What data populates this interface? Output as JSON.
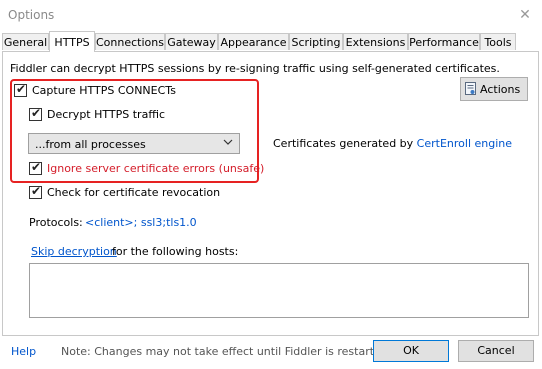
{
  "window": {
    "title": "Options"
  },
  "tabs": [
    {
      "label": "General"
    },
    {
      "label": "HTTPS"
    },
    {
      "label": "Connections"
    },
    {
      "label": "Gateway"
    },
    {
      "label": "Appearance"
    },
    {
      "label": "Scripting"
    },
    {
      "label": "Extensions"
    },
    {
      "label": "Performance"
    },
    {
      "label": "Tools"
    }
  ],
  "https": {
    "intro": "Fiddler can decrypt HTTPS sessions by re-signing traffic using self-generated certificates.",
    "capture_label": "Capture HTTPS CONNECTs",
    "capture_checked": true,
    "decrypt_label": "Decrypt HTTPS traffic",
    "decrypt_checked": true,
    "process_filter": "...from all processes",
    "ignore_errors_label": "Ignore server certificate errors (unsafe)",
    "ignore_errors_checked": true,
    "revocation_label": "Check for certificate revocation",
    "revocation_checked": true,
    "actions_label": "Actions",
    "cert_prefix": "Certificates generated by",
    "cert_engine": "CertEnroll engine",
    "protocols_label": "Protocols:",
    "protocols_value": "<client>; ssl3;tls1.0",
    "skip_link": "Skip decryption",
    "skip_suffix": "for the following hosts:",
    "skip_hosts": ""
  },
  "footer": {
    "help": "Help",
    "note": "Note: Changes may not take effect until Fiddler is restarted.",
    "ok": "OK",
    "cancel": "Cancel"
  },
  "colors": {
    "highlight": "#e62222",
    "link": "#0055cc",
    "warning_text": "#d41d2a"
  }
}
